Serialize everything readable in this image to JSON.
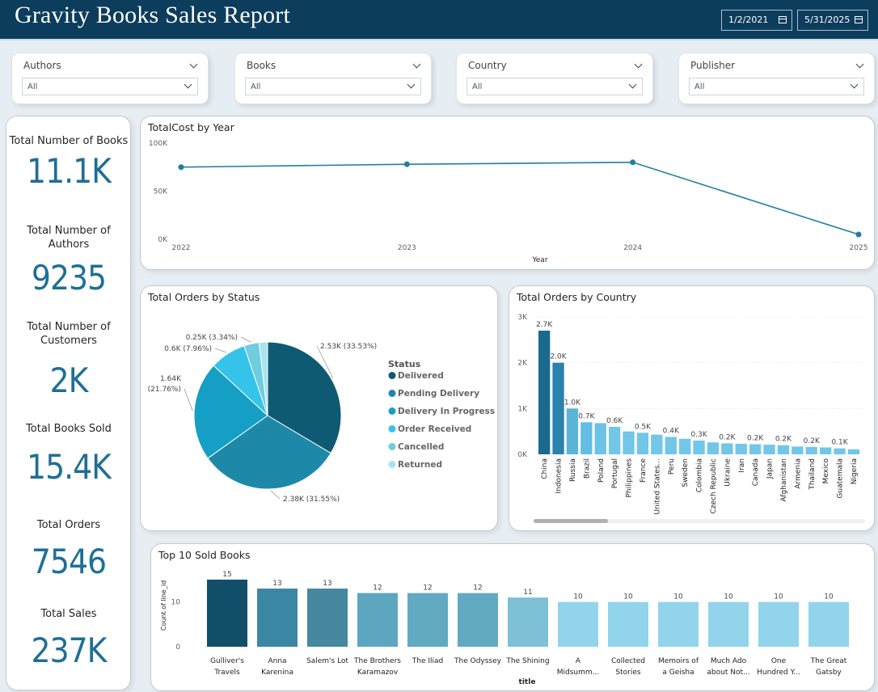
{
  "header": {
    "title": "Gravity Books Sales Report",
    "start_date": "1/2/2021",
    "end_date": "5/31/2025",
    "colors": {
      "header_bg": "#0d3d5c",
      "accent": "#1f6f95"
    }
  },
  "slicers": [
    {
      "label": "Authors",
      "value": "All"
    },
    {
      "label": "Books",
      "value": "All"
    },
    {
      "label": "Country",
      "value": "All"
    },
    {
      "label": "Publisher",
      "value": "All"
    }
  ],
  "kpis": [
    {
      "label": "Total Number of Books",
      "value": "11.1K"
    },
    {
      "label": "Total Number of Authors",
      "value": "9235"
    },
    {
      "label": "Total Number of Customers",
      "value": "2K"
    },
    {
      "label": "Total Books Sold",
      "value": "15.4K"
    },
    {
      "label": "Total Orders",
      "value": "7546"
    },
    {
      "label": "Total Sales",
      "value": "237K"
    }
  ],
  "chart_data": [
    {
      "type": "line",
      "title": "TotalCost by Year",
      "xlabel": "Year",
      "ylabel": "",
      "x": [
        "2022",
        "2023",
        "2024",
        "2025"
      ],
      "values": [
        75000,
        78000,
        80000,
        5000
      ],
      "ylim": [
        0,
        100000
      ],
      "yticks": [
        "0K",
        "50K",
        "100K"
      ],
      "color": "#1f7fa0"
    },
    {
      "type": "pie",
      "title": "Total Orders by Status",
      "legend_title": "Status",
      "legend_position": "right",
      "slices": [
        {
          "label": "Delivered",
          "value": 2530,
          "pct": 33.53,
          "text": "2.53K (33.53%)",
          "color": "#0f5a73"
        },
        {
          "label": "Pending Delivery",
          "value": 2380,
          "pct": 31.55,
          "text": "2.38K (31.55%)",
          "color": "#1e88a8"
        },
        {
          "label": "Delivery In Progress",
          "value": 1640,
          "pct": 21.76,
          "text": "1.64K (21.76%)",
          "color": "#169fc4"
        },
        {
          "label": "Order Received",
          "value": 600,
          "pct": 7.96,
          "text": "0.6K (7.96%)",
          "color": "#35c3ea"
        },
        {
          "label": "Cancelled",
          "value": 250,
          "pct": 3.34,
          "text": "0.25K (3.34%)",
          "color": "#6fcde0"
        },
        {
          "label": "Returned",
          "value": 140,
          "pct": 1.86,
          "text": "",
          "color": "#a8e4f0"
        }
      ]
    },
    {
      "type": "bar",
      "title": "Total Orders by Country",
      "categories": [
        "China",
        "Indonesia",
        "Russia",
        "Brazil",
        "Poland",
        "Portugal",
        "Philippines",
        "France",
        "United States...",
        "Peru",
        "Sweden",
        "Colombia",
        "Czech Republic",
        "Ukraine",
        "Iran",
        "Canada",
        "Japan",
        "Afghanistan",
        "Armenia",
        "Thailand",
        "Mexico",
        "Guatemala",
        "Nigeria"
      ],
      "values": [
        2700,
        2000,
        1000,
        700,
        680,
        600,
        500,
        470,
        430,
        380,
        340,
        300,
        260,
        240,
        230,
        220,
        210,
        200,
        170,
        160,
        150,
        130,
        110
      ],
      "data_labels": [
        "2.7K",
        "2.0K",
        "1.0K",
        "0.7K",
        "",
        "0.6K",
        "",
        "0.5K",
        "",
        "0.4K",
        "",
        "0.3K",
        "",
        "0.2K",
        "",
        "0.2K",
        "",
        "0.2K",
        "",
        "0.2K",
        "",
        "0.1K",
        ""
      ],
      "ylim": [
        0,
        3000
      ],
      "yticks": [
        "0K",
        "1K",
        "2K",
        "3K"
      ],
      "colors": [
        "#1a6a8f",
        "#2b82ad",
        "#5bb3d8",
        "#64bde2",
        "#6bc2e6",
        "#72c6e8"
      ]
    },
    {
      "type": "bar",
      "title": "Top 10 Sold Books",
      "xlabel": "title",
      "ylabel": "Count of line_id",
      "categories": [
        [
          "Gulliver's",
          "Travels"
        ],
        [
          "Anna",
          "Karenina"
        ],
        [
          "Salem's Lot"
        ],
        [
          "The Brothers",
          "Karamazov"
        ],
        [
          "The Iliad"
        ],
        [
          "The Odyssey"
        ],
        [
          "The Shining"
        ],
        [
          "A",
          "Midsumm..."
        ],
        [
          "Collected",
          "Stories"
        ],
        [
          "Memoirs of",
          "a Geisha"
        ],
        [
          "Much Ado",
          "about Not..."
        ],
        [
          "One",
          "Hundred Y..."
        ],
        [
          "The Great",
          "Gatsby"
        ]
      ],
      "values": [
        15,
        13,
        13,
        12,
        12,
        12,
        11,
        10,
        10,
        10,
        10,
        10,
        10
      ],
      "ylim": [
        0,
        15
      ],
      "yticks": [
        "0",
        "10"
      ],
      "colors": [
        "#124f6a",
        "#3a87a3",
        "#45889f",
        "#5ca6bf",
        "#62a9c2",
        "#62aac2",
        "#7ec0d6",
        "#92d4ec"
      ]
    }
  ]
}
